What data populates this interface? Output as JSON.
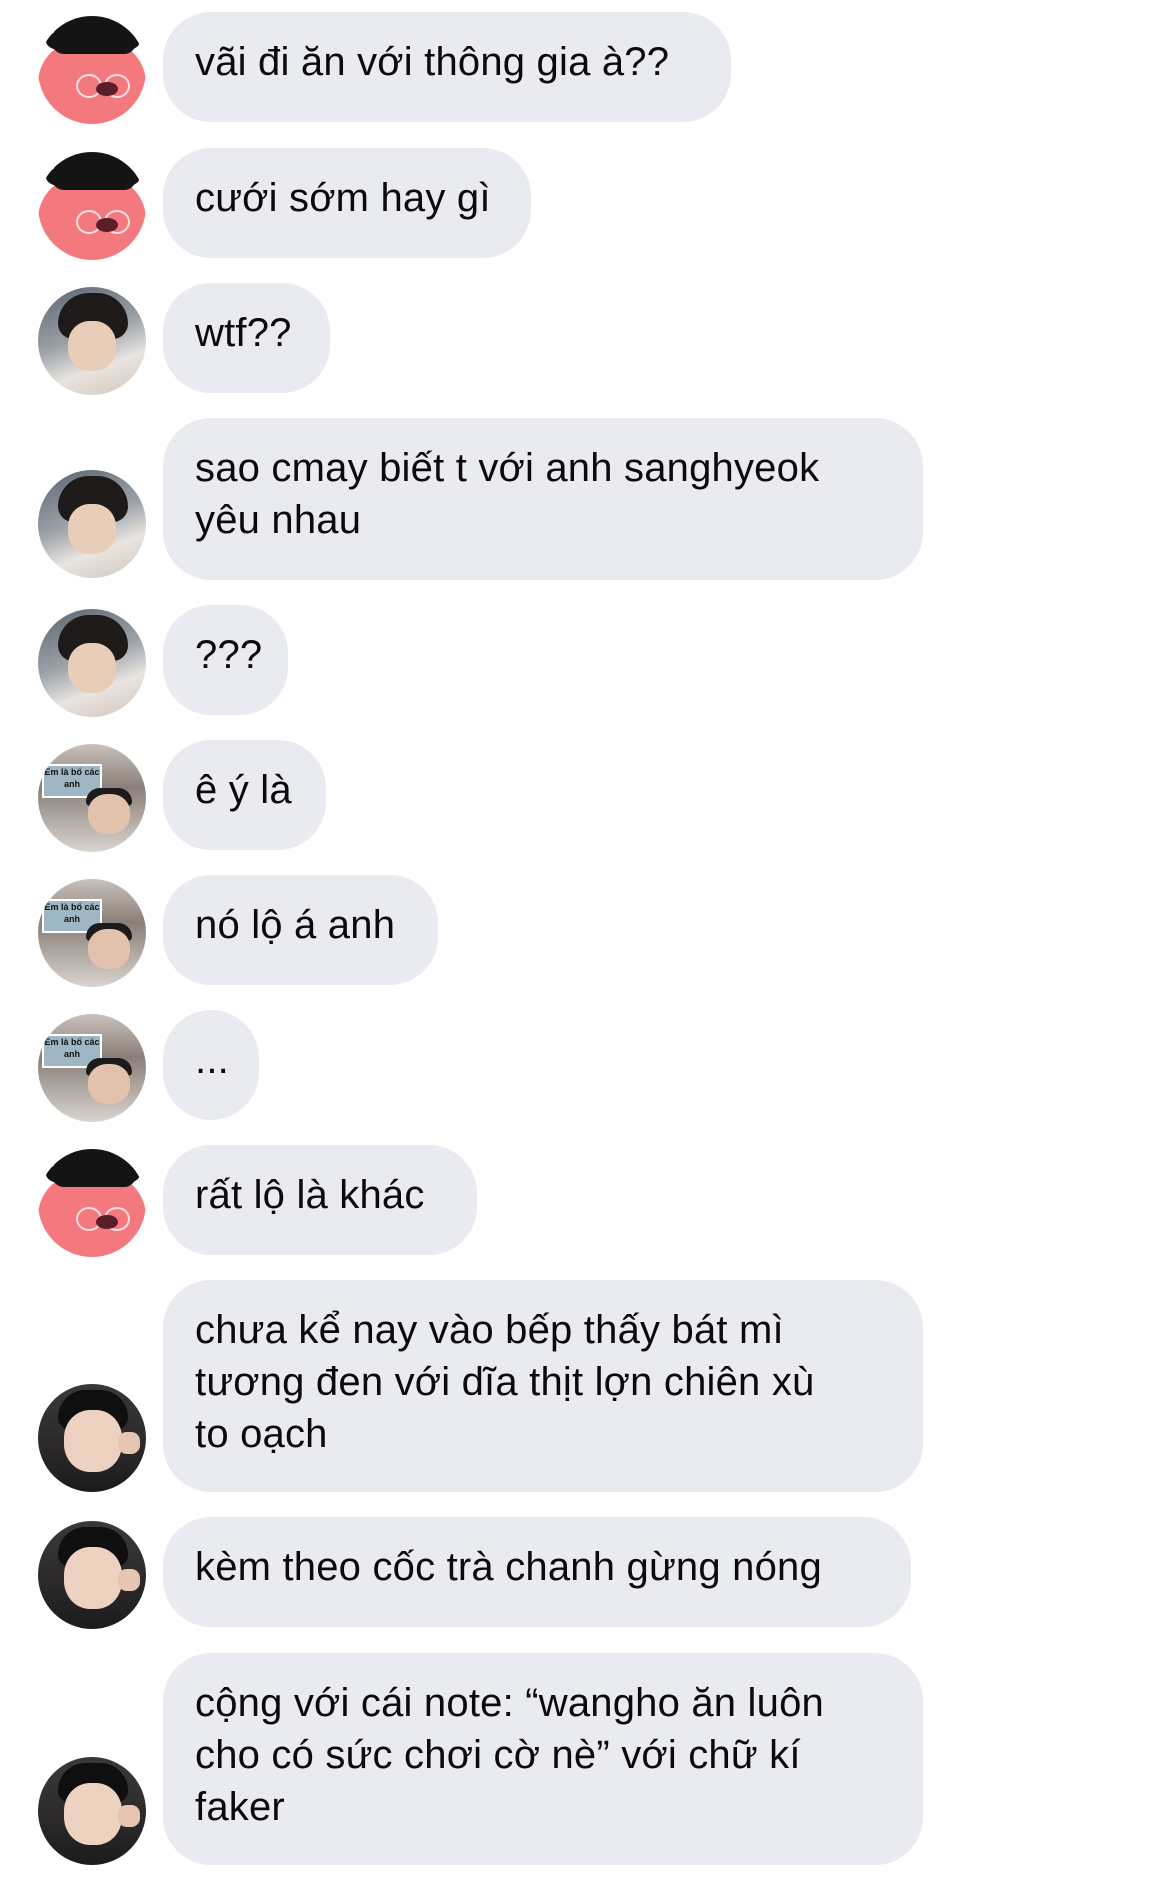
{
  "messages": [
    {
      "sender_avatar": "pig-avatar",
      "lines": [
        "vãi đi ăn với thông gia à??"
      ]
    },
    {
      "sender_avatar": "pig-avatar",
      "lines": [
        "cưới sớm hay gì"
      ]
    },
    {
      "sender_avatar": "photo-avatar-a",
      "lines": [
        "wtf??"
      ]
    },
    {
      "sender_avatar": "photo-avatar-a",
      "lines": [
        "sao cmay biết t với anh sanghyeok",
        "yêu nhau"
      ]
    },
    {
      "sender_avatar": "photo-avatar-a",
      "lines": [
        "???"
      ]
    },
    {
      "sender_avatar": "photo-avatar-b",
      "lines": [
        "ê ý là"
      ]
    },
    {
      "sender_avatar": "photo-avatar-b",
      "lines": [
        "nó lộ á anh"
      ]
    },
    {
      "sender_avatar": "photo-avatar-b",
      "lines": [
        "..."
      ]
    },
    {
      "sender_avatar": "pig-avatar",
      "lines": [
        "rất lộ là khác"
      ]
    },
    {
      "sender_avatar": "photo-avatar-c",
      "lines": [
        "chưa kể nay vào bếp thấy bát mì",
        "tương đen với dĩa thịt lợn chiên xù",
        "to oạch"
      ]
    },
    {
      "sender_avatar": "photo-avatar-c",
      "lines": [
        "kèm theo cốc trà chanh gừng nóng"
      ]
    },
    {
      "sender_avatar": "photo-avatar-c",
      "lines": [
        "cộng với cái note: “wangho ăn luôn",
        "cho có sức chơi cờ nè” với chữ kí",
        "faker"
      ]
    }
  ],
  "avatar_sign_text": "Em là bố các anh",
  "colors": {
    "bubble": "#e9ebf0",
    "text": "#0b0b0b",
    "background": "#ffffff"
  }
}
